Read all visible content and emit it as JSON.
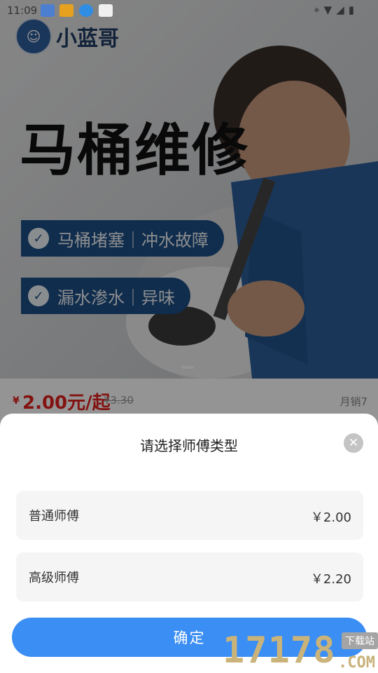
{
  "status_bar": {
    "time": "11:09"
  },
  "hero": {
    "brand": "小蓝哥",
    "title": "马桶维修",
    "tags": [
      "马桶堵塞｜冲水故障",
      "漏水渗水｜异味"
    ]
  },
  "product": {
    "currency": "¥",
    "price": "2.00元/起",
    "original_price": "¥3.30",
    "sales": "月销7"
  },
  "sheet": {
    "title": "请选择师傅类型",
    "options": [
      {
        "name": "普通师傅",
        "price": "￥2.00"
      },
      {
        "name": "高级师傅",
        "price": "￥2.20"
      }
    ],
    "confirm": "确定"
  },
  "watermark": {
    "number": "17178",
    "tag": "下载站",
    "domain": ".COM"
  },
  "colors": {
    "primary": "#3b8ef4",
    "price_red": "#e0221e",
    "tag_blue": "#1d4f86"
  },
  "icons": [
    "location-icon",
    "wifi-icon",
    "signal-icon",
    "battery-icon",
    "check-icon",
    "close-icon"
  ]
}
